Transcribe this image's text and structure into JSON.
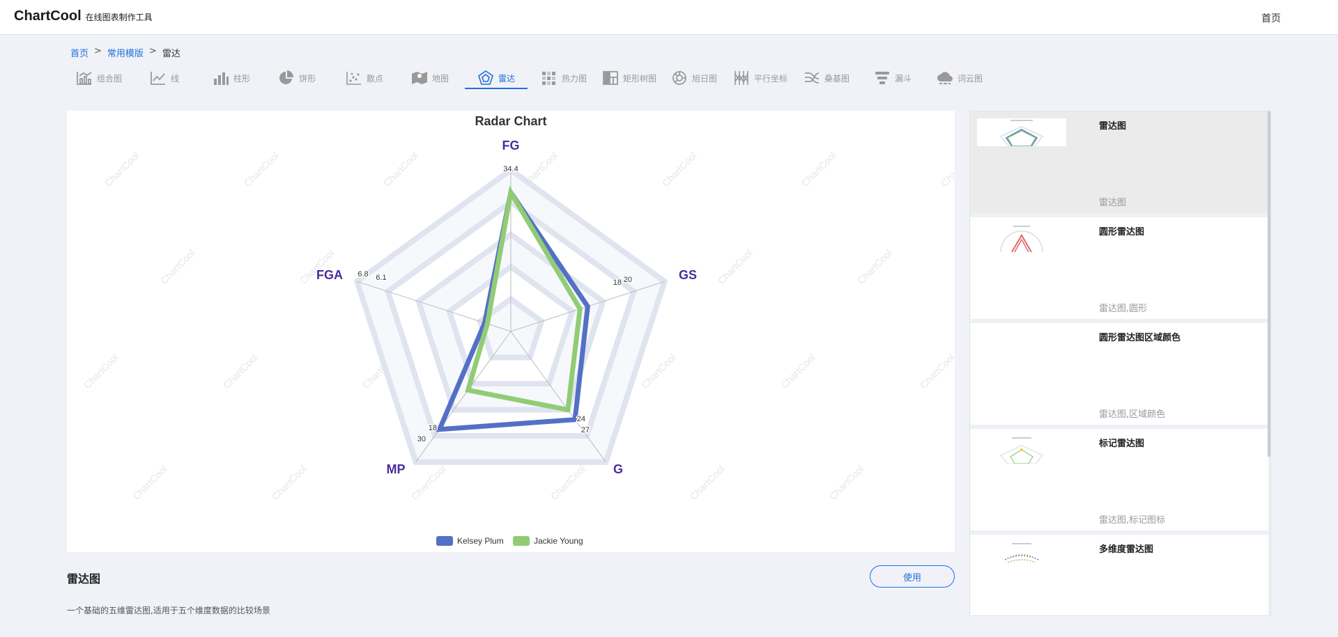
{
  "header": {
    "brand": "ChartCool",
    "subtitle": "在线图表制作工具",
    "home_link": "首页"
  },
  "breadcrumb": {
    "home": "首页",
    "sep1": ">",
    "templates": "常用模版",
    "sep2": ">",
    "current": "雷达"
  },
  "tabs": [
    {
      "label": "组合图",
      "icon": "combo-chart-icon"
    },
    {
      "label": "线",
      "icon": "line-chart-icon"
    },
    {
      "label": "柱形",
      "icon": "bar-chart-icon"
    },
    {
      "label": "饼形",
      "icon": "pie-chart-icon"
    },
    {
      "label": "散点",
      "icon": "scatter-chart-icon"
    },
    {
      "label": "地图",
      "icon": "map-icon"
    },
    {
      "label": "雷达",
      "icon": "radar-chart-icon",
      "active": true
    },
    {
      "label": "热力图",
      "icon": "heatmap-icon"
    },
    {
      "label": "矩形树图",
      "icon": "treemap-icon"
    },
    {
      "label": "旭日图",
      "icon": "sunburst-icon"
    },
    {
      "label": "平行坐标",
      "icon": "parallel-coordinates-icon"
    },
    {
      "label": "桑基图",
      "icon": "sankey-icon"
    },
    {
      "label": "漏斗",
      "icon": "funnel-icon"
    },
    {
      "label": "词云图",
      "icon": "word-cloud-icon"
    }
  ],
  "chart_data": {
    "type": "radar",
    "title": "Radar Chart",
    "indicators": [
      "FG",
      "GS",
      "G",
      "MP",
      "FGA"
    ],
    "max": 40,
    "series": [
      {
        "name": "Kelsey Plum",
        "values": [
          34.4,
          20,
          27,
          30,
          6.8
        ],
        "color": "#5470c6"
      },
      {
        "name": "Jackie Young",
        "values": [
          34.4,
          18,
          24,
          18,
          6.1
        ],
        "color": "#91cc75"
      }
    ],
    "data_labels": [
      {
        "text": "34.4"
      },
      {
        "text": "20"
      },
      {
        "text": "18"
      },
      {
        "text": "27"
      },
      {
        "text": "24"
      },
      {
        "text": "30"
      },
      {
        "text": "18"
      },
      {
        "text": "6.8"
      },
      {
        "text": "6.1"
      }
    ],
    "legend_position": "bottom-center",
    "indicator_color": "#4b2ca0",
    "watermark": "ChartCool"
  },
  "detail": {
    "title": "雷达图",
    "use_button": "使用",
    "description": "一个基础的五维雷达图,适用于五个维度数据的比较场景"
  },
  "sidebar": {
    "items": [
      {
        "name": "雷达图",
        "tags": "雷达图",
        "selected": true
      },
      {
        "name": "圆形雷达图",
        "tags": "雷达图,圆形"
      },
      {
        "name": "圆形雷达图区域颜色",
        "tags": "雷达图,区域颜色"
      },
      {
        "name": "标记雷达图",
        "tags": "雷达图,标记图标"
      },
      {
        "name": "多维度雷达图",
        "tags": ""
      }
    ]
  }
}
